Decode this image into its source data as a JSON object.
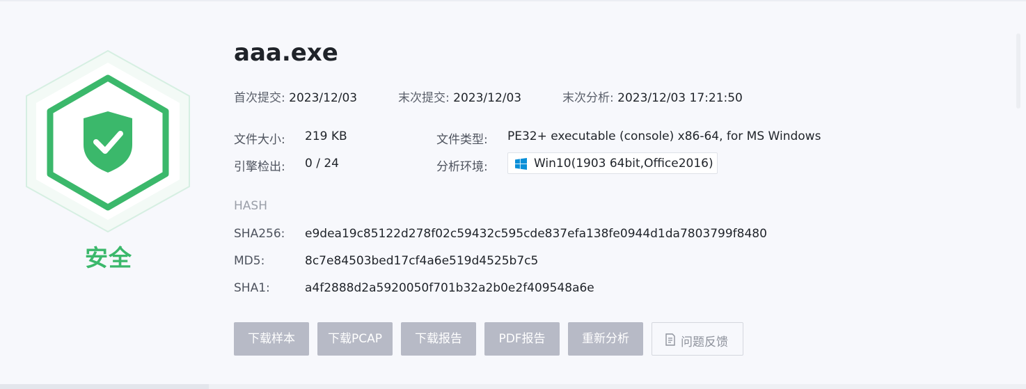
{
  "status": {
    "label": "安全",
    "color": "#3bb86b",
    "icon": "shield-check-icon"
  },
  "file": {
    "name": "aaa.exe"
  },
  "dates": [
    {
      "key": "首次提交:",
      "value": "2023/12/03"
    },
    {
      "key": "末次提交:",
      "value": "2023/12/03"
    },
    {
      "key": "末次分析:",
      "value": "2023/12/03 17:21:50"
    }
  ],
  "info": {
    "size_key": "文件大小:",
    "size_value": "219 KB",
    "type_key": "文件类型:",
    "type_value": "PE32+ executable (console) x86-64, for MS Windows",
    "engine_key": "引擎检出:",
    "engine_value": "0 / 24",
    "env_key": "分析环境:",
    "env_value": "Win10(1903 64bit,Office2016)",
    "env_icon": "windows-logo-icon"
  },
  "hash": {
    "title": "HASH",
    "sha256_key": "SHA256:",
    "sha256": "e9dea19c85122d278f02c59432c595cde837efa138fe0944d1da7803799f8480",
    "md5_key": "MD5:",
    "md5": "8c7e84503bed17cf4a6e519d4525b7c5",
    "sha1_key": "SHA1:",
    "sha1": "a4f2888d2a5920050f701b32a2b0e2f409548a6e"
  },
  "actions": {
    "download_sample": "下载样本",
    "download_pcap": "下载PCAP",
    "download_report": "下载报告",
    "pdf_report": "PDF报告",
    "reanalyze": "重新分析",
    "feedback": "问题反馈",
    "feedback_icon": "document-edit-icon"
  },
  "colors": {
    "button_bg": "#b7bac6",
    "accent_green": "#3bb86b",
    "background": "#f7f8fc"
  }
}
